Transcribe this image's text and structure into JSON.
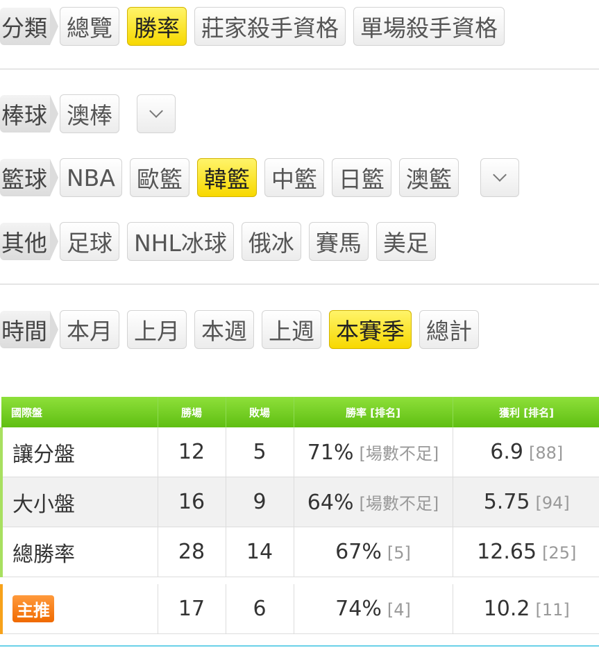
{
  "category": {
    "label": "分類",
    "options": [
      "總覽",
      "勝率",
      "莊家殺手資格",
      "單場殺手資格"
    ],
    "active": 1
  },
  "baseball": {
    "label": "棒球",
    "options": [
      "澳棒"
    ]
  },
  "basketball": {
    "label": "籃球",
    "options": [
      "NBA",
      "歐籃",
      "韓籃",
      "中籃",
      "日籃",
      "澳籃"
    ],
    "active": 2
  },
  "other": {
    "label": "其他",
    "options": [
      "足球",
      "NHL冰球",
      "俄冰",
      "賽馬",
      "美足"
    ]
  },
  "time": {
    "label": "時間",
    "options": [
      "本月",
      "上月",
      "本週",
      "上週",
      "本賽季",
      "總計"
    ],
    "active": 4
  },
  "table": {
    "headers": [
      "國際盤",
      "勝場",
      "敗場",
      "勝率 [排名]",
      "獲利 [排名]"
    ],
    "rows": [
      {
        "name": "讓分盤",
        "wins": "12",
        "losses": "5",
        "rate": "71%",
        "rate_rank": "[場數不足]",
        "profit": "6.9",
        "profit_rank": "[88]"
      },
      {
        "name": "大小盤",
        "wins": "16",
        "losses": "9",
        "rate": "64%",
        "rate_rank": "[場數不足]",
        "profit": "5.75",
        "profit_rank": "[94]"
      },
      {
        "name": "總勝率",
        "wins": "28",
        "losses": "14",
        "rate": "67%",
        "rate_rank": "[5]",
        "profit": "12.65",
        "profit_rank": "[25]"
      }
    ],
    "main_pick": {
      "badge": "主推",
      "wins": "17",
      "losses": "6",
      "rate": "74%",
      "rate_rank": "[4]",
      "profit": "10.2",
      "profit_rank": "[11]"
    }
  }
}
